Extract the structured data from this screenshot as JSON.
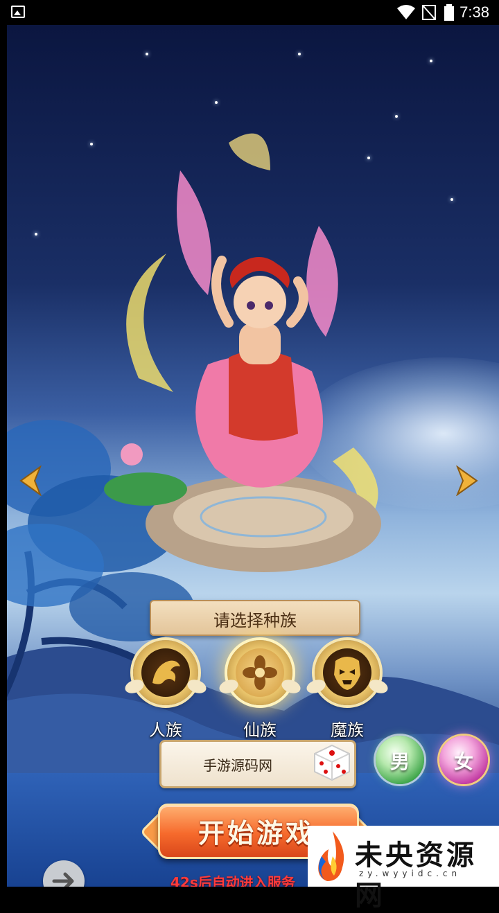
{
  "statusbar": {
    "time": "7:38"
  },
  "race_select": {
    "title": "请选择种族",
    "races": [
      {
        "label": "人族",
        "icon": "dragon-emblem-icon",
        "selected": false
      },
      {
        "label": "仙族",
        "icon": "lotus-emblem-icon",
        "selected": true
      },
      {
        "label": "魔族",
        "icon": "demon-mask-emblem-icon",
        "selected": false
      }
    ]
  },
  "name_field": {
    "value": "手游源码网",
    "randomize_icon": "dice-icon"
  },
  "gender": {
    "male_label": "男",
    "female_label": "女",
    "selected": "女"
  },
  "start_button": {
    "label": "开始游戏"
  },
  "countdown": {
    "text": "42s后自动进入服务"
  },
  "watermark": {
    "title": "未央资源网",
    "url": "zy.wyyidc.cn"
  },
  "colors": {
    "accent_orange": "#f66a2c",
    "countdown_red": "#ff3b3b",
    "banner_tan": "#e9cfa6"
  }
}
